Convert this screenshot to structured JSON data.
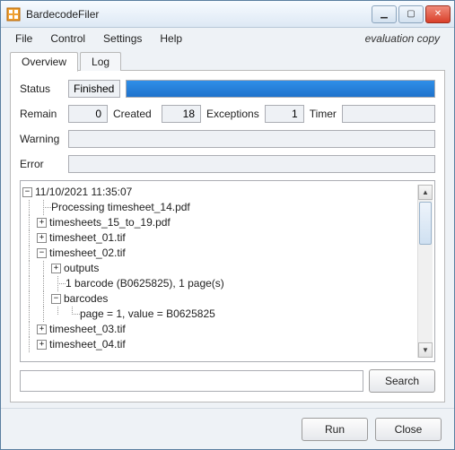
{
  "window": {
    "title": "BardecodeFiler",
    "eval_note": "evaluation copy"
  },
  "menu": {
    "file": "File",
    "control": "Control",
    "settings": "Settings",
    "help": "Help"
  },
  "tabs": {
    "overview": "Overview",
    "log": "Log"
  },
  "status": {
    "label": "Status",
    "value": "Finished",
    "remain_label": "Remain",
    "remain": "0",
    "created_label": "Created",
    "created": "18",
    "exceptions_label": "Exceptions",
    "exceptions": "1",
    "timer_label": "Timer",
    "timer": "",
    "warning_label": "Warning",
    "warning": "",
    "error_label": "Error",
    "error": ""
  },
  "tree": {
    "root": "11/10/2021 11:35:07",
    "items": [
      "Processing timesheet_14.pdf",
      "timesheets_15_to_19.pdf",
      "timesheet_01.tif",
      "timesheet_02.tif",
      "outputs",
      "1 barcode (B0625825), 1 page(s)",
      "barcodes",
      "page = 1, value = B0625825",
      "timesheet_03.tif",
      "timesheet_04.tif"
    ]
  },
  "search": {
    "value": "",
    "button": "Search"
  },
  "footer": {
    "run": "Run",
    "close": "Close"
  },
  "glyphs": {
    "minus": "−",
    "plus": "+"
  }
}
